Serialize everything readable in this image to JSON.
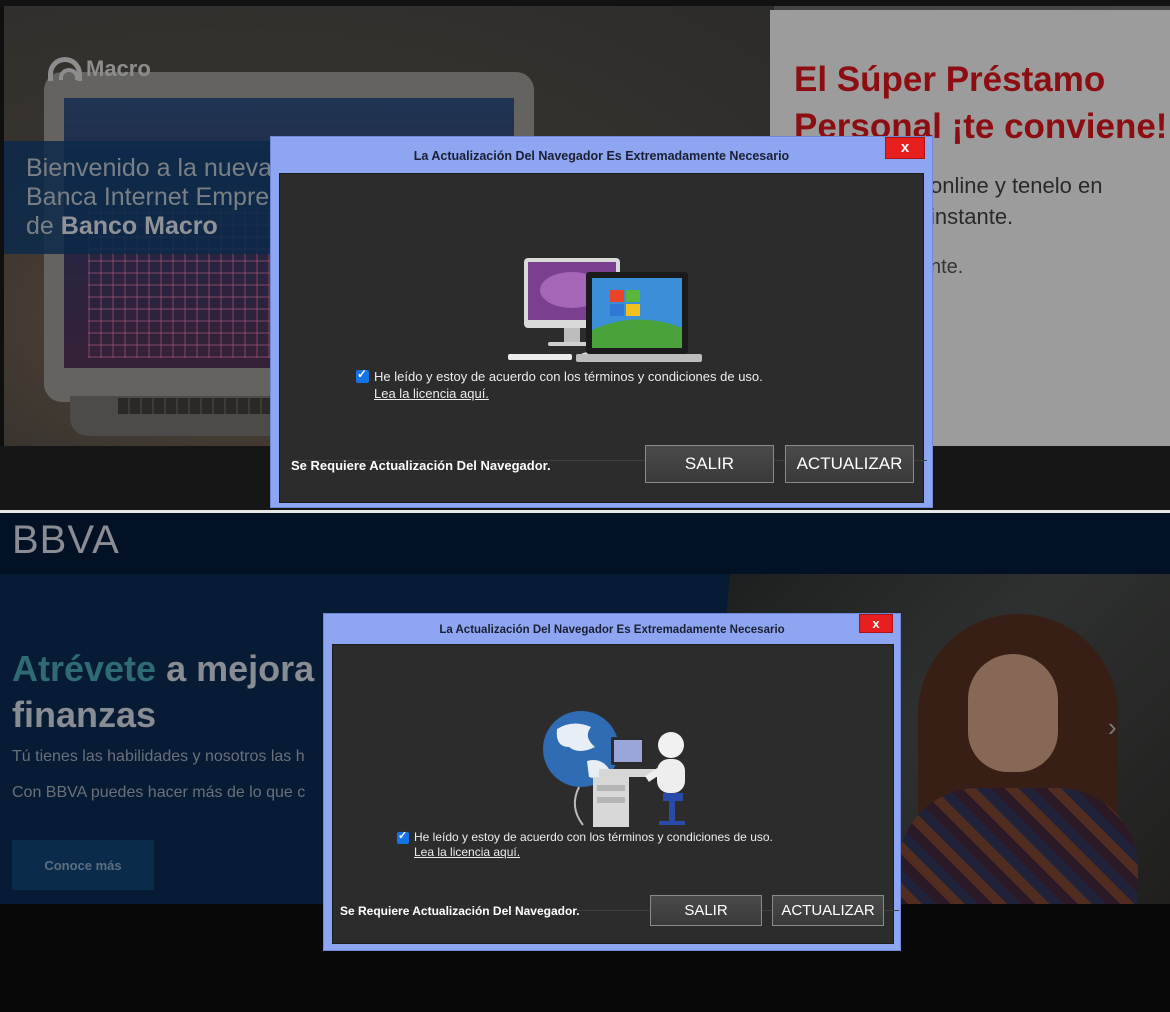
{
  "macro": {
    "logo_text": "Macro",
    "welcome_line1": "Bienvenido a la nueva",
    "welcome_line2": "Banca Internet Empre",
    "welcome_line3_prefix": "de ",
    "welcome_line3_bold": "Banco Macro",
    "promo_title": "El Súper Préstamo Personal ¡te conviene!",
    "promo_line1": "online y tenelo en",
    "promo_line2": "instante.",
    "promo_line3": "nte."
  },
  "bbva": {
    "logo_text": "BBVA",
    "headline_accent": "Atrévete",
    "headline_rest": " a mejora",
    "headline_line2": "finanzas",
    "sub1": "Tú tienes las habilidades y nosotros las h",
    "sub2": "Con BBVA puedes hacer más de lo que c",
    "cta_label": "Conoce más",
    "carousel_next_icon": "chevron-right-icon"
  },
  "dialog1": {
    "title": "La Actualización Del Navegador Es Extremadamente Necesario",
    "close_label": "x",
    "checkbox_checked": true,
    "checkbox_label": "He leído y estoy de acuerdo con los términos y condiciones de uso.",
    "license_link": "Lea la licencia aquí.",
    "requirement_text": "Se Requiere Actualización Del Navegador.",
    "exit_button": "SALIR",
    "update_button": "ACTUALIZAR",
    "image_icon": "computers-windows-icon"
  },
  "dialog2": {
    "title": "La Actualización Del Navegador Es Extremadamente Necesario",
    "close_label": "x",
    "checkbox_checked": true,
    "checkbox_label": "He leído y estoy de acuerdo con los términos y condiciones de uso.",
    "license_link": "Lea la licencia aquí.",
    "requirement_text": "Se Requiere Actualización Del Navegador.",
    "exit_button": "SALIR",
    "update_button": "ACTUALIZAR",
    "image_icon": "globe-computer-user-icon"
  },
  "colors": {
    "dialog_frame": "#8ea6f2",
    "dialog_body": "#2c2c2c",
    "close_red": "#e81f1f",
    "macro_red": "#c3141a",
    "bbva_navy": "#051732",
    "bbva_accent": "#3f8f98"
  }
}
